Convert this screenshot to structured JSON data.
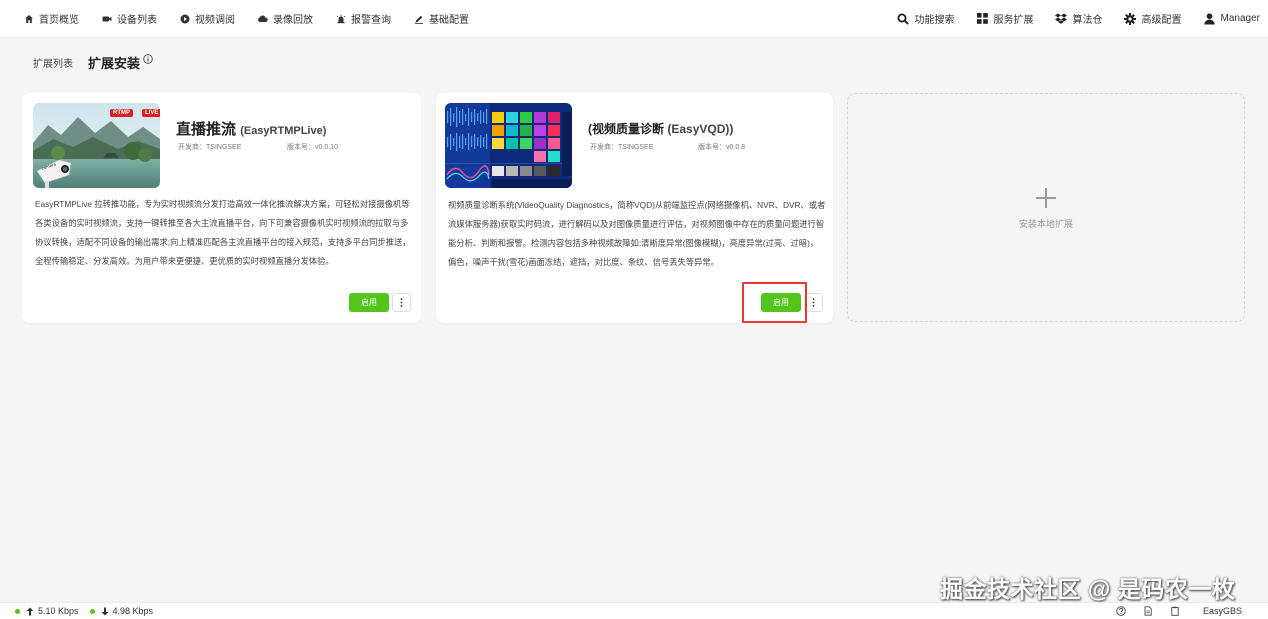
{
  "nav": {
    "left": [
      {
        "label": "首页概览",
        "icon": "home-icon"
      },
      {
        "label": "设备列表",
        "icon": "camera-icon"
      },
      {
        "label": "视频调阅",
        "icon": "play-circle-icon"
      },
      {
        "label": "录像回放",
        "icon": "cloud-icon"
      },
      {
        "label": "报警查询",
        "icon": "alarm-icon"
      },
      {
        "label": "基础配置",
        "icon": "edit-icon"
      }
    ],
    "right": [
      {
        "label": "功能搜索",
        "icon": "search-icon"
      },
      {
        "label": "服务扩展",
        "icon": "grid-icon"
      },
      {
        "label": "算法仓",
        "icon": "dropbox-icon"
      },
      {
        "label": "高级配置",
        "icon": "gear-icon"
      },
      {
        "label": "Manager",
        "icon": "user-icon"
      }
    ]
  },
  "tabs": [
    {
      "label": "扩展列表",
      "active": false
    },
    {
      "label": "扩展安装",
      "active": true
    }
  ],
  "cards": [
    {
      "title": "直播推流",
      "subtitle": "(EasyRTMPLive)",
      "developer": "开发商：TSINGSEE",
      "version": "版本号：v0.0.10",
      "badges": [
        "RTMP",
        "LIVE"
      ],
      "description": "EasyRTMPLive 拉转推功能，专为实时视频流分发打造高效一体化推流解决方案，可轻松对接摄像机等各类设备的实时视频流，支持一键转推至各大主流直播平台，向下可兼容摄像机实时视频流的拉取与多协议转换，适配不同设备的输出需求;向上精准匹配各主流直播平台的接入规范，支持多平台同步推送，全程传输稳定、分发高效。为用户带来更便捷、更优质的实时视频直播分发体验。",
      "enable_label": "启用"
    },
    {
      "title": "(视频质量诊断",
      "subtitle": "(EasyVQD))",
      "developer": "开发商：TSINGSEE",
      "version": "版本号：v0.0.8",
      "description": "视频质量诊断系统(VideoQuality Diagnostics，简称VQD)从前端监控点(网络摄像机、NVR、DVR、或者流媒体服务器)获取实时码流，进行解码以及对图像质量进行评估，对视频图像中存在的质量问题进行智能分析、判断和报警。检测内容包括多种视频故障如:清晰度异常(图像模糊)，亮度异常(过亮、过暗)，偏色，噪声干扰(雪花)画面冻结，遮挡，对比度、条纹、信号丢失等异常。",
      "enable_label": "启用"
    }
  ],
  "add_card": {
    "label": "安装本地扩展"
  },
  "watermark": "掘金技术社区 @ 是码农一枚",
  "status": {
    "upload": "5.10 Kbps",
    "download": "4.98 Kbps",
    "app_name": "EasyGBS"
  },
  "colors": {
    "accent_green": "#52c41a",
    "highlight_red": "#e53935"
  }
}
